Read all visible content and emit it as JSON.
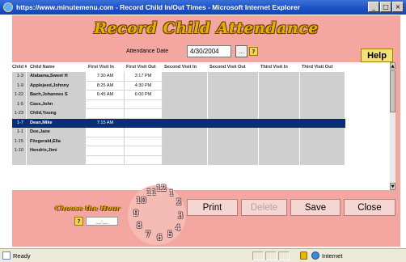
{
  "window": {
    "title": "https://www.minutemenu.com - Record Child In/Out Times - Microsoft Internet Explorer",
    "minimize": "_",
    "maximize": "□",
    "close": "×"
  },
  "page": {
    "heading": "Record Child Attendance",
    "date_label": "Attendance Date",
    "date_value": "4/30/2004",
    "calendar_btn": "...",
    "help_q": "?",
    "help_label": "Help"
  },
  "grid": {
    "headers": [
      "Child #",
      "Child Name",
      "First Visit In",
      "First Visit Out",
      "Second Visit In",
      "Second Visit Out",
      "Third Visit In",
      "Third Visit Out"
    ],
    "rows": [
      {
        "id": "1-3",
        "name": "Alabama,Sweet H",
        "in1": "7:30 AM",
        "out1": "3:17 PM",
        "selected": false
      },
      {
        "id": "1-9",
        "name": "Applejeed,Johnny",
        "in1": "8:25 AM",
        "out1": "4:30 PM",
        "selected": false
      },
      {
        "id": "1-22",
        "name": "Bach,Johannes S",
        "in1": "6:45 AM",
        "out1": "6:00 PM",
        "selected": false
      },
      {
        "id": "1-5",
        "name": "Cass,John",
        "in1": "",
        "out1": "",
        "selected": false
      },
      {
        "id": "1-23",
        "name": "Child,Young",
        "in1": "",
        "out1": "",
        "selected": false
      },
      {
        "id": "1-7",
        "name": "Dean,Mike",
        "in1": "7:15 AM",
        "out1": "",
        "selected": true
      },
      {
        "id": "1-1",
        "name": "Doe,Jane",
        "in1": "",
        "out1": "",
        "selected": false
      },
      {
        "id": "1-15",
        "name": "Fitzgerald,Ella",
        "in1": "",
        "out1": "",
        "selected": false
      },
      {
        "id": "1-10",
        "name": "Hendrix,Jimi",
        "in1": "",
        "out1": "",
        "selected": false
      },
      {
        "id": "",
        "name": "",
        "in1": "",
        "out1": "",
        "selected": false
      }
    ],
    "scroll_up": "▲",
    "scroll_down": "▼"
  },
  "controls": {
    "hour_label": "Choose the Hour",
    "hour_q": "?",
    "hour_value": "__:__",
    "clock_numbers": [
      "11",
      "12",
      "1",
      "10",
      "2",
      "9",
      "3",
      "8",
      "4",
      "7",
      "6",
      "5"
    ],
    "print": "Print",
    "delete": "Delete",
    "save": "Save",
    "close": "Close"
  },
  "status": {
    "ready": "Ready",
    "zone": "Internet"
  },
  "colors": {
    "panel": "#f4a6a0",
    "heading": "#d7b800",
    "selected_row": "#0b2c78",
    "titlebar": "#1b4fc4"
  }
}
